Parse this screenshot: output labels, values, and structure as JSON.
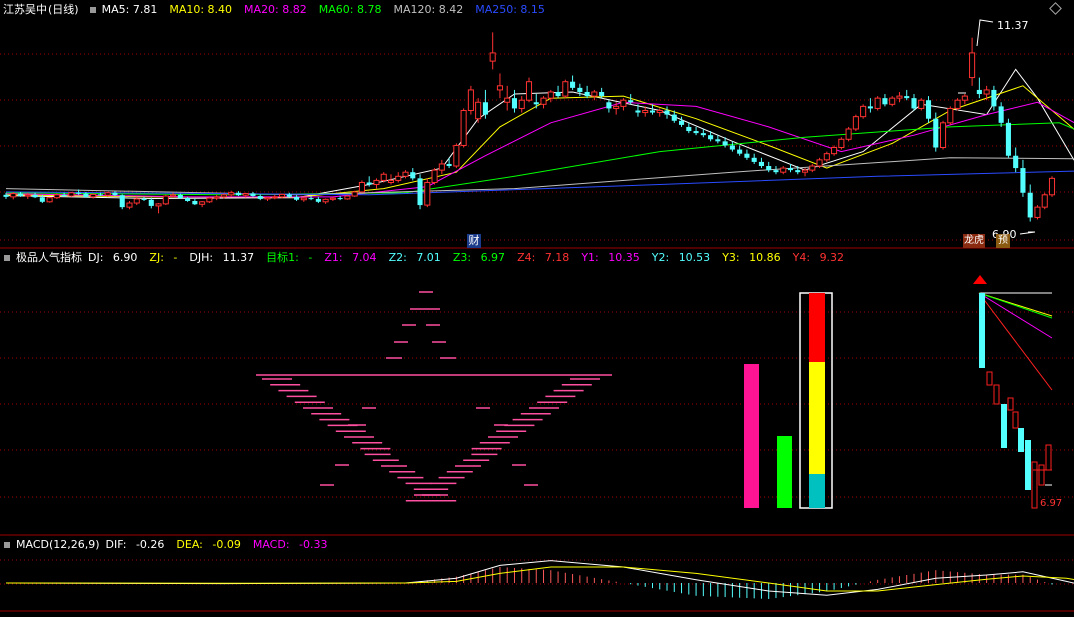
{
  "colors": {
    "background": "#000000",
    "grid": "#a00000",
    "up": "#ff3232",
    "down": "#54ffff",
    "ma5": "#ffffff",
    "ma10": "#ffff00",
    "ma20": "#ff00ff",
    "ma60": "#00ff00",
    "ma120": "#c0c0c0",
    "ma250": "#2a4bff",
    "dif": "#ffffff",
    "dea": "#ffff00",
    "macd": "#ff00ff"
  },
  "main_panel": {
    "stock_name": "江苏吴中",
    "period": "(日线)",
    "ma": [
      {
        "label": "MA5:",
        "value": "7.81"
      },
      {
        "label": "MA10:",
        "value": "8.40"
      },
      {
        "label": "MA20:",
        "value": "8.82"
      },
      {
        "label": "MA60:",
        "value": "8.78"
      },
      {
        "label": "MA120:",
        "value": "8.42"
      },
      {
        "label": "MA250:",
        "value": "8.15"
      }
    ],
    "high_marker": "11.37",
    "low_marker": "6.90",
    "badge_cai": "财",
    "badge_longhu": "龙虎",
    "badge_yu": "预"
  },
  "indicator_panel": {
    "title": "极品人气指标",
    "items": [
      {
        "label": "DJ:",
        "value": "6.90"
      },
      {
        "label": "ZJ:",
        "value": "-"
      },
      {
        "label": "DJH:",
        "value": "11.37"
      },
      {
        "label": "目标1:",
        "value": "-"
      },
      {
        "label": "Z1:",
        "value": "7.04"
      },
      {
        "label": "Z2:",
        "value": "7.01"
      },
      {
        "label": "Z3:",
        "value": "6.97"
      },
      {
        "label": "Z4:",
        "value": "7.18"
      },
      {
        "label": "Y1:",
        "value": "10.35"
      },
      {
        "label": "Y2:",
        "value": "10.53"
      },
      {
        "label": "Y3:",
        "value": "10.86"
      },
      {
        "label": "Y4:",
        "value": "9.32"
      }
    ],
    "low_marker": "6.97"
  },
  "macd_panel": {
    "title": "MACD(12,26,9)",
    "items": [
      {
        "label": "DIF:",
        "value": "-0.26"
      },
      {
        "label": "DEA:",
        "value": "-0.09"
      },
      {
        "label": "MACD:",
        "value": "-0.33"
      }
    ]
  },
  "chart_data": {
    "type": "candlestick",
    "title": "江苏吴中 (日线)",
    "ylim": [
      6.5,
      11.8
    ],
    "candles": [
      [
        7.55,
        7.6,
        7.45,
        7.5
      ],
      [
        7.5,
        7.62,
        7.44,
        7.58
      ],
      [
        7.58,
        7.62,
        7.5,
        7.52
      ],
      [
        7.52,
        7.6,
        7.45,
        7.55
      ],
      [
        7.55,
        7.6,
        7.47,
        7.49
      ],
      [
        7.49,
        7.55,
        7.35,
        7.38
      ],
      [
        7.38,
        7.5,
        7.36,
        7.48
      ],
      [
        7.48,
        7.58,
        7.45,
        7.55
      ],
      [
        7.55,
        7.6,
        7.5,
        7.52
      ],
      [
        7.52,
        7.62,
        7.5,
        7.6
      ],
      [
        7.6,
        7.68,
        7.55,
        7.58
      ],
      [
        7.58,
        7.62,
        7.48,
        7.5
      ],
      [
        7.5,
        7.58,
        7.46,
        7.56
      ],
      [
        7.56,
        7.6,
        7.52,
        7.54
      ],
      [
        7.54,
        7.62,
        7.5,
        7.6
      ],
      [
        7.6,
        7.64,
        7.52,
        7.54
      ],
      [
        7.54,
        7.56,
        7.2,
        7.25
      ],
      [
        7.25,
        7.4,
        7.2,
        7.35
      ],
      [
        7.35,
        7.5,
        7.3,
        7.45
      ],
      [
        7.45,
        7.5,
        7.4,
        7.43
      ],
      [
        7.43,
        7.48,
        7.22,
        7.28
      ],
      [
        7.28,
        7.35,
        7.1,
        7.33
      ],
      [
        7.33,
        7.55,
        7.3,
        7.52
      ],
      [
        7.52,
        7.6,
        7.48,
        7.55
      ],
      [
        7.55,
        7.58,
        7.45,
        7.47
      ],
      [
        7.47,
        7.5,
        7.38,
        7.4
      ],
      [
        7.4,
        7.45,
        7.3,
        7.32
      ],
      [
        7.32,
        7.4,
        7.25,
        7.38
      ],
      [
        7.38,
        7.5,
        7.35,
        7.47
      ],
      [
        7.47,
        7.55,
        7.42,
        7.5
      ],
      [
        7.5,
        7.58,
        7.46,
        7.55
      ],
      [
        7.55,
        7.65,
        7.5,
        7.6
      ],
      [
        7.6,
        7.64,
        7.52,
        7.54
      ],
      [
        7.54,
        7.6,
        7.48,
        7.58
      ],
      [
        7.58,
        7.62,
        7.5,
        7.52
      ],
      [
        7.52,
        7.56,
        7.42,
        7.45
      ],
      [
        7.45,
        7.5,
        7.4,
        7.48
      ],
      [
        7.48,
        7.55,
        7.44,
        7.5
      ],
      [
        7.5,
        7.58,
        7.46,
        7.56
      ],
      [
        7.56,
        7.6,
        7.48,
        7.5
      ],
      [
        7.5,
        7.54,
        7.4,
        7.43
      ],
      [
        7.43,
        7.5,
        7.38,
        7.47
      ],
      [
        7.47,
        7.52,
        7.42,
        7.45
      ],
      [
        7.45,
        7.5,
        7.35,
        7.38
      ],
      [
        7.38,
        7.46,
        7.33,
        7.44
      ],
      [
        7.44,
        7.5,
        7.4,
        7.47
      ],
      [
        7.47,
        7.52,
        7.42,
        7.45
      ],
      [
        7.45,
        7.55,
        7.43,
        7.52
      ],
      [
        7.52,
        7.65,
        7.5,
        7.62
      ],
      [
        7.62,
        7.9,
        7.6,
        7.85
      ],
      [
        7.85,
        8.0,
        7.75,
        7.8
      ],
      [
        7.8,
        7.95,
        7.7,
        7.9
      ],
      [
        7.9,
        8.1,
        7.85,
        8.05
      ],
      [
        7.85,
        8.05,
        7.8,
        7.9
      ],
      [
        7.9,
        8.1,
        7.85,
        8.0
      ],
      [
        8.0,
        8.15,
        7.95,
        8.1
      ],
      [
        8.1,
        8.2,
        7.9,
        7.95
      ],
      [
        7.95,
        8.05,
        7.2,
        7.3
      ],
      [
        7.3,
        7.95,
        7.25,
        7.85
      ],
      [
        7.85,
        8.2,
        7.8,
        8.15
      ],
      [
        8.15,
        8.4,
        8.05,
        8.3
      ],
      [
        8.3,
        8.45,
        8.2,
        8.25
      ],
      [
        8.25,
        8.8,
        8.2,
        8.75
      ],
      [
        8.75,
        9.65,
        8.7,
        9.6
      ],
      [
        9.6,
        10.2,
        9.5,
        10.1
      ],
      [
        9.4,
        9.9,
        9.3,
        9.8
      ],
      [
        9.8,
        10.1,
        9.4,
        9.5
      ],
      [
        10.8,
        11.5,
        10.6,
        11.0
      ],
      [
        10.1,
        10.5,
        9.9,
        10.2
      ],
      [
        9.8,
        10.2,
        9.6,
        9.9
      ],
      [
        9.9,
        10.1,
        9.55,
        9.65
      ],
      [
        9.65,
        9.95,
        9.55,
        9.85
      ],
      [
        9.85,
        10.4,
        9.8,
        10.3
      ],
      [
        9.8,
        10.0,
        9.65,
        9.75
      ],
      [
        9.75,
        9.95,
        9.65,
        9.9
      ],
      [
        9.9,
        10.1,
        9.8,
        10.05
      ],
      [
        10.05,
        10.2,
        9.9,
        9.95
      ],
      [
        9.95,
        10.35,
        9.9,
        10.3
      ],
      [
        10.3,
        10.45,
        10.1,
        10.15
      ],
      [
        10.15,
        10.25,
        9.95,
        10.05
      ],
      [
        10.05,
        10.2,
        9.9,
        9.95
      ],
      [
        9.95,
        10.1,
        9.85,
        10.05
      ],
      [
        10.05,
        10.15,
        9.9,
        9.95
      ],
      [
        9.8,
        9.85,
        9.55,
        9.65
      ],
      [
        9.65,
        9.8,
        9.5,
        9.7
      ],
      [
        9.7,
        9.9,
        9.6,
        9.85
      ],
      [
        9.85,
        10.0,
        9.75,
        9.8
      ],
      [
        9.6,
        9.75,
        9.45,
        9.55
      ],
      [
        9.55,
        9.7,
        9.45,
        9.6
      ],
      [
        9.6,
        9.75,
        9.5,
        9.55
      ],
      [
        9.55,
        9.65,
        9.45,
        9.6
      ],
      [
        9.6,
        9.7,
        9.4,
        9.5
      ],
      [
        9.5,
        9.6,
        9.3,
        9.35
      ],
      [
        9.35,
        9.45,
        9.2,
        9.25
      ],
      [
        9.2,
        9.3,
        9.05,
        9.1
      ],
      [
        9.1,
        9.2,
        9.0,
        9.05
      ],
      [
        9.05,
        9.15,
        8.95,
        9.0
      ],
      [
        9.0,
        9.1,
        8.85,
        8.9
      ],
      [
        8.9,
        9.0,
        8.8,
        8.85
      ],
      [
        8.85,
        8.95,
        8.7,
        8.75
      ],
      [
        8.75,
        8.85,
        8.6,
        8.65
      ],
      [
        8.65,
        8.75,
        8.5,
        8.55
      ],
      [
        8.55,
        8.65,
        8.4,
        8.45
      ],
      [
        8.45,
        8.55,
        8.3,
        8.35
      ],
      [
        8.35,
        8.45,
        8.2,
        8.25
      ],
      [
        8.25,
        8.35,
        8.1,
        8.15
      ],
      [
        8.15,
        8.25,
        8.05,
        8.1
      ],
      [
        8.1,
        8.25,
        8.05,
        8.2
      ],
      [
        8.2,
        8.3,
        8.1,
        8.15
      ],
      [
        8.15,
        8.25,
        8.05,
        8.1
      ],
      [
        8.1,
        8.2,
        8.0,
        8.15
      ],
      [
        8.15,
        8.3,
        8.1,
        8.25
      ],
      [
        8.25,
        8.45,
        8.2,
        8.4
      ],
      [
        8.4,
        8.6,
        8.35,
        8.55
      ],
      [
        8.55,
        8.75,
        8.5,
        8.7
      ],
      [
        8.7,
        8.95,
        8.65,
        8.9
      ],
      [
        8.9,
        9.2,
        8.85,
        9.15
      ],
      [
        9.15,
        9.5,
        9.1,
        9.45
      ],
      [
        9.45,
        9.75,
        9.4,
        9.7
      ],
      [
        9.7,
        9.9,
        9.55,
        9.65
      ],
      [
        9.65,
        9.95,
        9.6,
        9.9
      ],
      [
        9.9,
        10.0,
        9.7,
        9.75
      ],
      [
        9.75,
        9.95,
        9.7,
        9.9
      ],
      [
        9.9,
        10.05,
        9.8,
        9.95
      ],
      [
        9.95,
        10.1,
        9.85,
        9.9
      ],
      [
        9.9,
        10.0,
        9.6,
        9.65
      ],
      [
        9.65,
        9.9,
        9.6,
        9.85
      ],
      [
        9.85,
        9.95,
        9.3,
        9.4
      ],
      [
        9.4,
        9.55,
        8.6,
        8.7
      ],
      [
        8.7,
        9.35,
        8.65,
        9.3
      ],
      [
        9.3,
        9.7,
        9.25,
        9.65
      ],
      [
        9.65,
        9.9,
        9.6,
        9.85
      ],
      [
        9.85,
        10.0,
        9.75,
        9.95
      ],
      [
        10.4,
        11.37,
        10.2,
        11.0
      ],
      [
        10.1,
        10.4,
        9.9,
        10.0
      ],
      [
        10.0,
        10.2,
        9.85,
        10.1
      ],
      [
        10.1,
        10.2,
        9.6,
        9.7
      ],
      [
        9.7,
        9.8,
        9.2,
        9.3
      ],
      [
        9.3,
        9.4,
        8.45,
        8.5
      ],
      [
        8.5,
        8.7,
        8.1,
        8.2
      ],
      [
        8.2,
        8.4,
        7.5,
        7.6
      ],
      [
        7.6,
        7.8,
        6.9,
        7.0
      ],
      [
        7.0,
        7.3,
        6.95,
        7.25
      ],
      [
        7.25,
        7.6,
        7.2,
        7.55
      ],
      [
        7.55,
        8.0,
        7.5,
        7.95
      ]
    ],
    "ma_series": [
      {
        "name": "MA5",
        "points": [
          [
            0,
            7.53
          ],
          [
            20,
            7.46
          ],
          [
            40,
            7.48
          ],
          [
            50,
            7.8
          ],
          [
            60,
            8.2
          ],
          [
            65,
            9.4
          ],
          [
            70,
            10.0
          ],
          [
            78,
            10.05
          ],
          [
            90,
            9.6
          ],
          [
            100,
            8.85
          ],
          [
            110,
            8.15
          ],
          [
            118,
            8.6
          ],
          [
            126,
            9.75
          ],
          [
            135,
            9.5
          ],
          [
            139,
            10.6
          ],
          [
            142,
            9.9
          ],
          [
            147,
            8.4
          ],
          [
            152,
            7.81
          ]
        ]
      },
      {
        "name": "MA10",
        "points": [
          [
            0,
            7.55
          ],
          [
            20,
            7.5
          ],
          [
            40,
            7.49
          ],
          [
            52,
            7.7
          ],
          [
            62,
            8.1
          ],
          [
            68,
            9.2
          ],
          [
            75,
            9.9
          ],
          [
            85,
            9.95
          ],
          [
            95,
            9.4
          ],
          [
            105,
            8.75
          ],
          [
            113,
            8.2
          ],
          [
            122,
            8.8
          ],
          [
            130,
            9.6
          ],
          [
            140,
            10.2
          ],
          [
            146,
            9.3
          ],
          [
            152,
            8.4
          ]
        ]
      },
      {
        "name": "MA20",
        "points": [
          [
            0,
            7.58
          ],
          [
            25,
            7.5
          ],
          [
            45,
            7.5
          ],
          [
            58,
            7.75
          ],
          [
            66,
            8.5
          ],
          [
            75,
            9.3
          ],
          [
            85,
            9.8
          ],
          [
            95,
            9.7
          ],
          [
            105,
            9.2
          ],
          [
            115,
            8.6
          ],
          [
            125,
            9.0
          ],
          [
            135,
            9.5
          ],
          [
            142,
            9.8
          ],
          [
            152,
            8.82
          ]
        ]
      },
      {
        "name": "MA60",
        "points": [
          [
            0,
            7.6
          ],
          [
            30,
            7.55
          ],
          [
            55,
            7.6
          ],
          [
            70,
            8.0
          ],
          [
            90,
            8.6
          ],
          [
            110,
            8.95
          ],
          [
            130,
            9.2
          ],
          [
            145,
            9.3
          ],
          [
            152,
            8.78
          ]
        ]
      },
      {
        "name": "MA120",
        "points": [
          [
            0,
            7.7
          ],
          [
            40,
            7.55
          ],
          [
            70,
            7.7
          ],
          [
            100,
            8.1
          ],
          [
            130,
            8.45
          ],
          [
            152,
            8.42
          ]
        ]
      },
      {
        "name": "MA250",
        "points": [
          [
            0,
            7.62
          ],
          [
            50,
            7.55
          ],
          [
            90,
            7.8
          ],
          [
            120,
            8.0
          ],
          [
            152,
            8.15
          ]
        ]
      }
    ],
    "macd": {
      "dif": [
        [
          0,
          0.0
        ],
        [
          30,
          -0.02
        ],
        [
          55,
          0.0
        ],
        [
          62,
          0.15
        ],
        [
          68,
          0.55
        ],
        [
          75,
          0.7
        ],
        [
          85,
          0.5
        ],
        [
          95,
          0.1
        ],
        [
          105,
          -0.25
        ],
        [
          113,
          -0.38
        ],
        [
          120,
          -0.2
        ],
        [
          128,
          0.15
        ],
        [
          135,
          0.25
        ],
        [
          140,
          0.35
        ],
        [
          146,
          0.05
        ],
        [
          152,
          -0.26
        ]
      ],
      "dea": [
        [
          0,
          0.0
        ],
        [
          30,
          -0.01
        ],
        [
          55,
          0.0
        ],
        [
          62,
          0.05
        ],
        [
          68,
          0.3
        ],
        [
          75,
          0.5
        ],
        [
          85,
          0.5
        ],
        [
          95,
          0.3
        ],
        [
          105,
          0.0
        ],
        [
          113,
          -0.25
        ],
        [
          120,
          -0.25
        ],
        [
          128,
          -0.05
        ],
        [
          135,
          0.12
        ],
        [
          140,
          0.22
        ],
        [
          146,
          0.15
        ],
        [
          152,
          -0.09
        ]
      ]
    }
  }
}
